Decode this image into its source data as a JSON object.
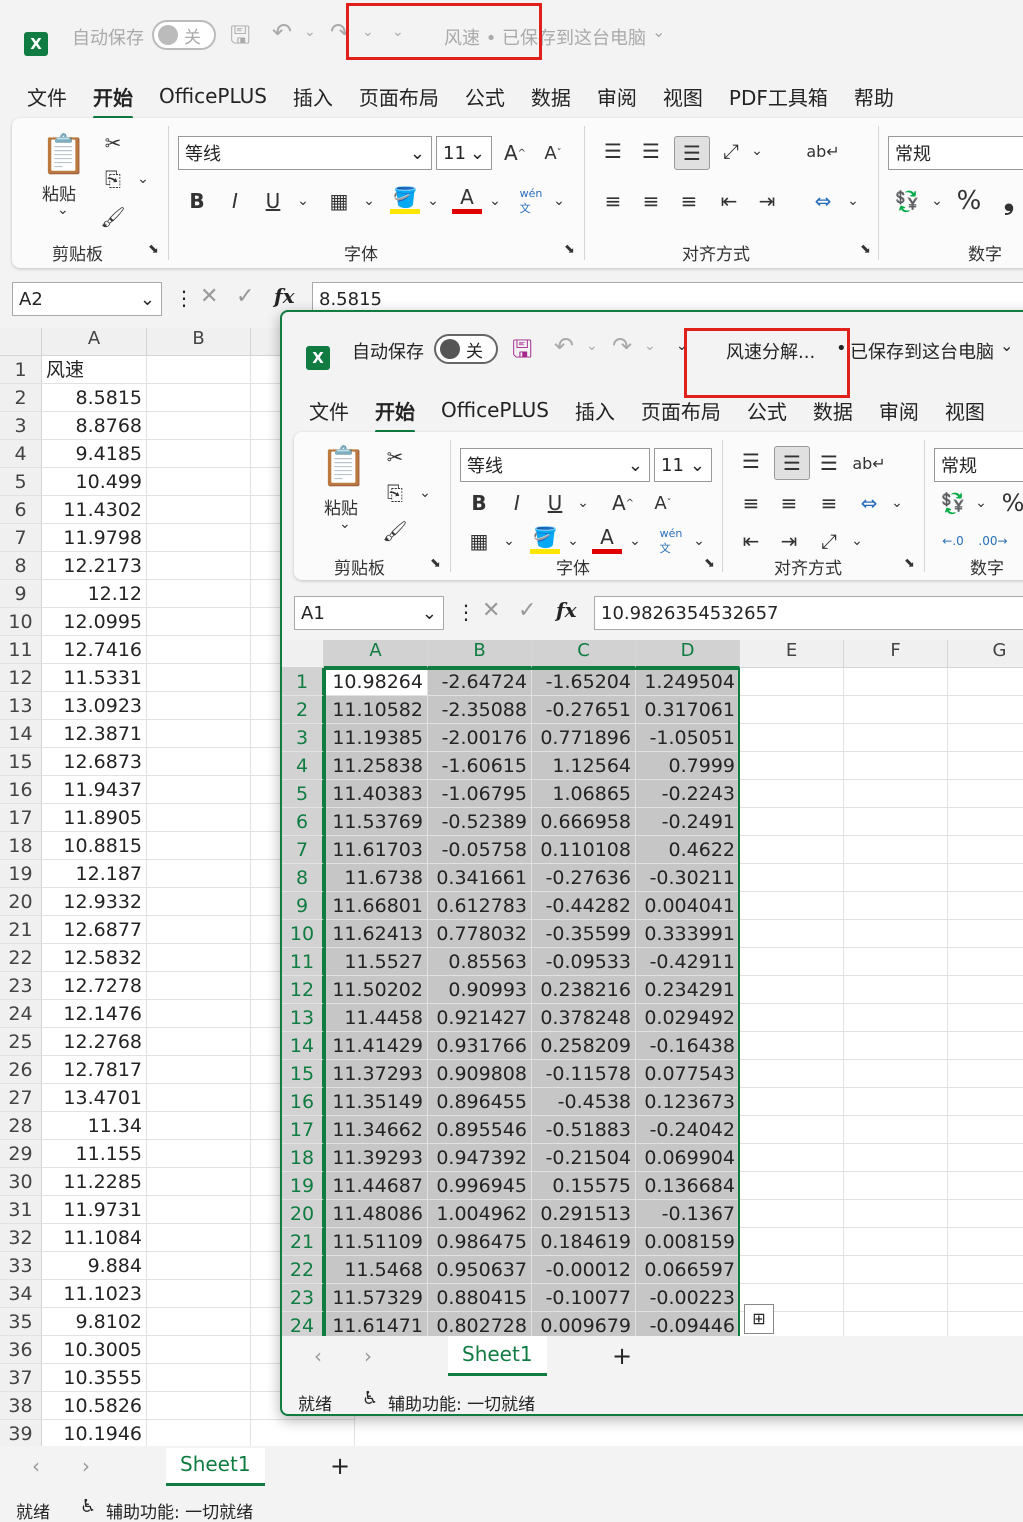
{
  "back": {
    "autosave_label": "自动保存",
    "toggle_label": "关",
    "title": "风速 • 已保存到这台电脑",
    "menu": [
      "文件",
      "开始",
      "OfficePLUS",
      "插入",
      "页面布局",
      "公式",
      "数据",
      "审阅",
      "视图",
      "PDF工具箱",
      "帮助"
    ],
    "ribbon": {
      "paste": "粘贴",
      "clipboard": "剪贴板",
      "font_name": "等线",
      "font_size": "11",
      "font": "字体",
      "align": "对齐方式",
      "number_format": "常规",
      "number": "数字",
      "percent": "%"
    },
    "namebox": "A2",
    "formula": "8.5815",
    "fx": "fx",
    "col_headers": [
      "A",
      "B"
    ],
    "rows": [
      "风速",
      "8.5815",
      "8.8768",
      "9.4185",
      "10.499",
      "11.4302",
      "11.9798",
      "12.2173",
      "12.12",
      "12.0995",
      "12.7416",
      "11.5331",
      "13.0923",
      "12.3871",
      "12.6873",
      "11.9437",
      "11.8905",
      "10.8815",
      "12.187",
      "12.9332",
      "12.6877",
      "12.5832",
      "12.7278",
      "12.1476",
      "12.2768",
      "12.7817",
      "13.4701",
      "11.34",
      "11.155",
      "11.2285",
      "11.9731",
      "11.1084",
      "9.884",
      "11.1023",
      "9.8102",
      "10.3005",
      "10.3555",
      "10.5826",
      "10.1946"
    ],
    "sheet_tab": "Sheet1",
    "status": "就绪",
    "accessibility": "辅助功能: 一切就绪"
  },
  "front": {
    "autosave_label": "自动保存",
    "toggle_label": "关",
    "title": "风速分解...",
    "saved": "已保存到这台电脑",
    "menu": [
      "文件",
      "开始",
      "OfficePLUS",
      "插入",
      "页面布局",
      "公式",
      "数据",
      "审阅",
      "视图"
    ],
    "ribbon": {
      "paste": "粘贴",
      "clipboard": "剪贴板",
      "font_name": "等线",
      "font_size": "11",
      "font": "字体",
      "align": "对齐方式",
      "number_format": "常规",
      "number": "数字"
    },
    "namebox": "A1",
    "formula": "10.9826354532657",
    "fx": "fx",
    "col_headers": [
      "A",
      "B",
      "C",
      "D",
      "E",
      "F",
      "G"
    ],
    "rows": [
      [
        "10.98264",
        "-2.64724",
        "-1.65204",
        "1.249504"
      ],
      [
        "11.10582",
        "-2.35088",
        "-0.27651",
        "0.317061"
      ],
      [
        "11.19385",
        "-2.00176",
        "0.771896",
        "-1.05051"
      ],
      [
        "11.25838",
        "-1.60615",
        "1.12564",
        "0.7999"
      ],
      [
        "11.40383",
        "-1.06795",
        "1.06865",
        "-0.2243"
      ],
      [
        "11.53769",
        "-0.52389",
        "0.666958",
        "-0.2491"
      ],
      [
        "11.61703",
        "-0.05758",
        "0.110108",
        "0.4622"
      ],
      [
        "11.6738",
        "0.341661",
        "-0.27636",
        "-0.30211"
      ],
      [
        "11.66801",
        "0.612783",
        "-0.44282",
        "0.004041"
      ],
      [
        "11.62413",
        "0.778032",
        "-0.35599",
        "0.333991"
      ],
      [
        "11.5527",
        "0.85563",
        "-0.09533",
        "-0.42911"
      ],
      [
        "11.50202",
        "0.90993",
        "0.238216",
        "0.234291"
      ],
      [
        "11.4458",
        "0.921427",
        "0.378248",
        "0.029492"
      ],
      [
        "11.41429",
        "0.931766",
        "0.258209",
        "-0.16438"
      ],
      [
        "11.37293",
        "0.909808",
        "-0.11578",
        "0.077543"
      ],
      [
        "11.35149",
        "0.896455",
        "-0.4538",
        "0.123673"
      ],
      [
        "11.34662",
        "0.895546",
        "-0.51883",
        "-0.24042"
      ],
      [
        "11.39293",
        "0.947392",
        "-0.21504",
        "0.069904"
      ],
      [
        "11.44687",
        "0.996945",
        "0.15575",
        "0.136684"
      ],
      [
        "11.48086",
        "1.004962",
        "0.291513",
        "-0.1367"
      ],
      [
        "11.51109",
        "0.986475",
        "0.184619",
        "0.008159"
      ],
      [
        "11.5468",
        "0.950637",
        "-0.00012",
        "0.066597"
      ],
      [
        "11.57329",
        "0.880415",
        "-0.10077",
        "-0.00223"
      ],
      [
        "11.61471",
        "0.802728",
        "0.009679",
        "-0.09446"
      ]
    ],
    "sheet_tab": "Sheet1",
    "status": "就绪",
    "accessibility": "辅助功能: 一切就绪"
  },
  "colors": {
    "excel_green": "#107c41",
    "highlight_red": "#e0201b",
    "selection_gray": "#c6c6c6"
  }
}
